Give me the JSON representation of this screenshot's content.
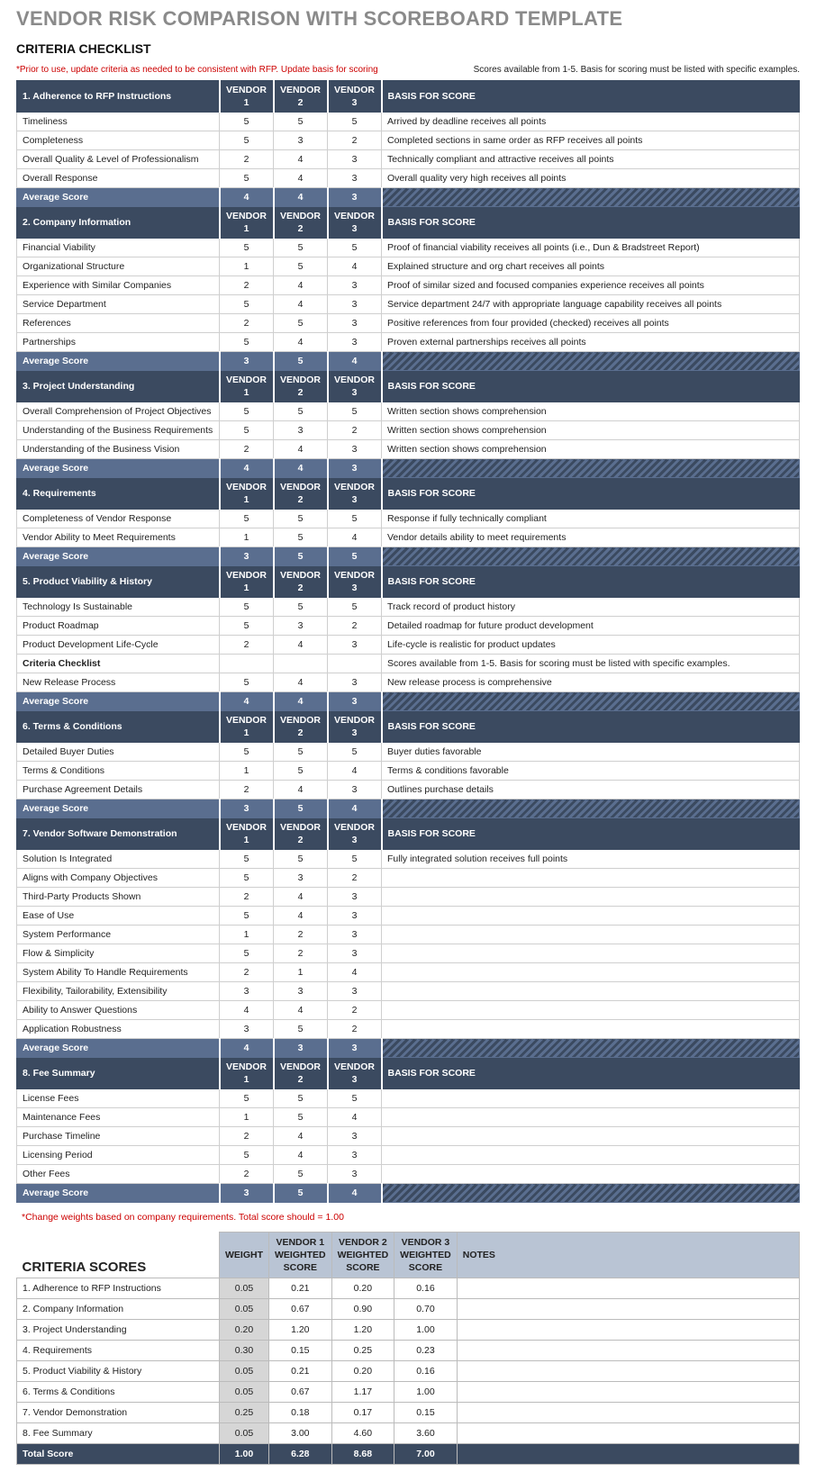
{
  "main_title": "VENDOR RISK COMPARISON WITH SCOREBOARD TEMPLATE",
  "sub_title": "CRITERIA CHECKLIST",
  "note_left": "*Prior to use, update criteria as needed to be consistent with RFP. Update basis for scoring",
  "note_right": "Scores available from 1-5. Basis for scoring must be listed with specific examples.",
  "vendor_labels": [
    "VENDOR 1",
    "VENDOR 2",
    "VENDOR 3"
  ],
  "basis_label": "BASIS FOR SCORE",
  "avg_label": "Average Score",
  "sections": [
    {
      "title": "1. Adherence to RFP Instructions",
      "rows": [
        {
          "c": "Timeliness",
          "v": [
            "5",
            "5",
            "5"
          ],
          "b": "Arrived by deadline receives all points"
        },
        {
          "c": "Completeness",
          "v": [
            "5",
            "3",
            "2"
          ],
          "b": "Completed sections in same order as RFP receives all points"
        },
        {
          "c": "Overall Quality & Level of Professionalism",
          "v": [
            "2",
            "4",
            "3"
          ],
          "b": "Technically compliant and attractive receives all points"
        },
        {
          "c": "Overall Response",
          "v": [
            "5",
            "4",
            "3"
          ],
          "b": "Overall quality very high receives all points"
        }
      ],
      "avg": [
        "4",
        "4",
        "3"
      ]
    },
    {
      "title": "2. Company Information",
      "rows": [
        {
          "c": "Financial Viability",
          "v": [
            "5",
            "5",
            "5"
          ],
          "b": "Proof of financial viability receives all points (i.e., Dun & Bradstreet Report)"
        },
        {
          "c": "Organizational Structure",
          "v": [
            "1",
            "5",
            "4"
          ],
          "b": "Explained structure and org chart receives all points"
        },
        {
          "c": "Experience with Similar Companies",
          "v": [
            "2",
            "4",
            "3"
          ],
          "b": "Proof of similar sized and focused companies experience receives all points"
        },
        {
          "c": "Service Department",
          "v": [
            "5",
            "4",
            "3"
          ],
          "b": "Service department 24/7 with appropriate language capability receives all points"
        },
        {
          "c": "References",
          "v": [
            "2",
            "5",
            "3"
          ],
          "b": "Positive references from four provided (checked) receives all points"
        },
        {
          "c": "Partnerships",
          "v": [
            "5",
            "4",
            "3"
          ],
          "b": "Proven external partnerships receives all points"
        }
      ],
      "avg": [
        "3",
        "5",
        "4"
      ]
    },
    {
      "title": "3. Project Understanding",
      "rows": [
        {
          "c": "Overall Comprehension of Project Objectives",
          "v": [
            "5",
            "5",
            "5"
          ],
          "b": "Written section shows comprehension"
        },
        {
          "c": "Understanding of the Business Requirements",
          "v": [
            "5",
            "3",
            "2"
          ],
          "b": "Written section shows comprehension"
        },
        {
          "c": "Understanding of the Business Vision",
          "v": [
            "2",
            "4",
            "3"
          ],
          "b": "Written section shows comprehension"
        }
      ],
      "avg": [
        "4",
        "4",
        "3"
      ]
    },
    {
      "title": "4. Requirements",
      "rows": [
        {
          "c": "Completeness of Vendor Response",
          "v": [
            "5",
            "5",
            "5"
          ],
          "b": "Response if fully technically compliant"
        },
        {
          "c": "Vendor Ability to Meet Requirements",
          "v": [
            "1",
            "5",
            "4"
          ],
          "b": "Vendor details ability to meet requirements"
        }
      ],
      "avg": [
        "3",
        "5",
        "5"
      ]
    },
    {
      "title": "5. Product Viability & History",
      "rows": [
        {
          "c": "Technology Is Sustainable",
          "v": [
            "5",
            "5",
            "5"
          ],
          "b": "Track record of product history"
        },
        {
          "c": "Product Roadmap",
          "v": [
            "5",
            "3",
            "2"
          ],
          "b": "Detailed roadmap for future product development"
        },
        {
          "c": "Product Development Life-Cycle",
          "v": [
            "2",
            "4",
            "3"
          ],
          "b": "Life-cycle is realistic for product updates"
        },
        {
          "c": "Criteria Checklist",
          "v": [
            "",
            "",
            ""
          ],
          "b": "Scores available from 1-5. Basis for scoring must be listed with specific examples.",
          "bold": true
        },
        {
          "c": "New Release Process",
          "v": [
            "5",
            "4",
            "3"
          ],
          "b": "New release process is comprehensive"
        }
      ],
      "avg": [
        "4",
        "4",
        "3"
      ]
    },
    {
      "title": "6. Terms & Conditions",
      "rows": [
        {
          "c": "Detailed Buyer Duties",
          "v": [
            "5",
            "5",
            "5"
          ],
          "b": "Buyer duties favorable"
        },
        {
          "c": "Terms & Conditions",
          "v": [
            "1",
            "5",
            "4"
          ],
          "b": "Terms & conditions favorable"
        },
        {
          "c": "Purchase Agreement Details",
          "v": [
            "2",
            "4",
            "3"
          ],
          "b": "Outlines purchase details"
        }
      ],
      "avg": [
        "3",
        "5",
        "4"
      ]
    },
    {
      "title": "7. Vendor Software Demonstration",
      "rows": [
        {
          "c": "Solution Is Integrated",
          "v": [
            "5",
            "5",
            "5"
          ],
          "b": "Fully integrated solution receives full points"
        },
        {
          "c": "Aligns with Company Objectives",
          "v": [
            "5",
            "3",
            "2"
          ],
          "b": ""
        },
        {
          "c": "Third-Party Products Shown",
          "v": [
            "2",
            "4",
            "3"
          ],
          "b": ""
        },
        {
          "c": "Ease of Use",
          "v": [
            "5",
            "4",
            "3"
          ],
          "b": ""
        },
        {
          "c": "System Performance",
          "v": [
            "1",
            "2",
            "3"
          ],
          "b": ""
        },
        {
          "c": "Flow & Simplicity",
          "v": [
            "5",
            "2",
            "3"
          ],
          "b": ""
        },
        {
          "c": "System Ability To Handle Requirements",
          "v": [
            "2",
            "1",
            "4"
          ],
          "b": ""
        },
        {
          "c": "Flexibility, Tailorability, Extensibility",
          "v": [
            "3",
            "3",
            "3"
          ],
          "b": ""
        },
        {
          "c": "Ability to Answer Questions",
          "v": [
            "4",
            "4",
            "2"
          ],
          "b": ""
        },
        {
          "c": "Application Robustness",
          "v": [
            "3",
            "5",
            "2"
          ],
          "b": ""
        }
      ],
      "avg": [
        "4",
        "3",
        "3"
      ]
    },
    {
      "title": "8. Fee Summary",
      "rows": [
        {
          "c": "License Fees",
          "v": [
            "5",
            "5",
            "5"
          ],
          "b": ""
        },
        {
          "c": "Maintenance Fees",
          "v": [
            "1",
            "5",
            "4"
          ],
          "b": ""
        },
        {
          "c": "Purchase Timeline",
          "v": [
            "2",
            "4",
            "3"
          ],
          "b": ""
        },
        {
          "c": "Licensing Period",
          "v": [
            "5",
            "4",
            "3"
          ],
          "b": ""
        },
        {
          "c": "Other Fees",
          "v": [
            "2",
            "5",
            "3"
          ],
          "b": ""
        }
      ],
      "avg": [
        "3",
        "5",
        "4"
      ]
    }
  ],
  "footnote": "*Change weights based on company requirements. Total score should = 1.00",
  "scores": {
    "title": "CRITERIA SCORES",
    "headers": [
      "WEIGHT",
      "VENDOR 1 WEIGHTED SCORE",
      "VENDOR 2 WEIGHTED SCORE",
      "VENDOR 3 WEIGHTED SCORE",
      "NOTES"
    ],
    "rows": [
      {
        "c": "1. Adherence to RFP Instructions",
        "w": "0.05",
        "v": [
          "0.21",
          "0.20",
          "0.16"
        ],
        "n": ""
      },
      {
        "c": "2. Company Information",
        "w": "0.05",
        "v": [
          "0.67",
          "0.90",
          "0.70"
        ],
        "n": ""
      },
      {
        "c": "3. Project Understanding",
        "w": "0.20",
        "v": [
          "1.20",
          "1.20",
          "1.00"
        ],
        "n": ""
      },
      {
        "c": "4. Requirements",
        "w": "0.30",
        "v": [
          "0.15",
          "0.25",
          "0.23"
        ],
        "n": ""
      },
      {
        "c": "5. Product Viability & History",
        "w": "0.05",
        "v": [
          "0.21",
          "0.20",
          "0.16"
        ],
        "n": ""
      },
      {
        "c": "6. Terms & Conditions",
        "w": "0.05",
        "v": [
          "0.67",
          "1.17",
          "1.00"
        ],
        "n": ""
      },
      {
        "c": "7. Vendor Demonstration",
        "w": "0.25",
        "v": [
          "0.18",
          "0.17",
          "0.15"
        ],
        "n": ""
      },
      {
        "c": "8. Fee Summary",
        "w": "0.05",
        "v": [
          "3.00",
          "4.60",
          "3.60"
        ],
        "n": ""
      }
    ],
    "total": {
      "label": "Total Score",
      "w": "1.00",
      "v": [
        "6.28",
        "8.68",
        "7.00"
      ]
    }
  }
}
